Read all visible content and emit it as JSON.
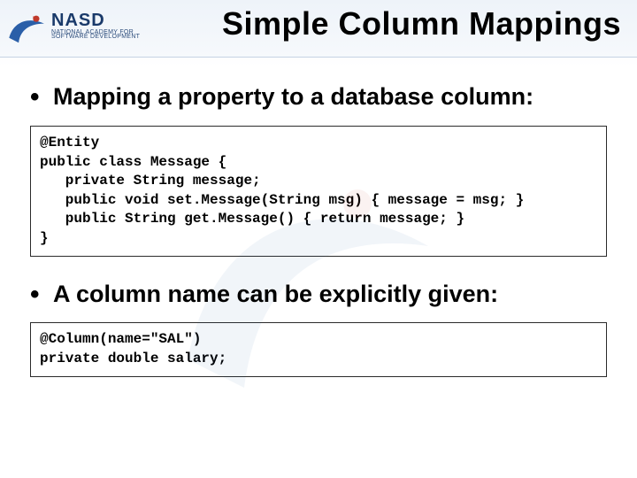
{
  "logo": {
    "name": "NASD",
    "sub1": "NATIONAL ACADEMY FOR",
    "sub2": "SOFTWARE DEVELOPMENT"
  },
  "title": "Simple Column Mappings",
  "bullets": [
    "Mapping a property to a database column:",
    "A column name can be explicitly given:"
  ],
  "code": {
    "block1": "@Entity\npublic class Message {\n   private String message;\n   public void set.Message(String msg) { message = msg; }\n   public String get.Message() { return message; }\n}",
    "block2": "@Column(name=\"SAL\")\nprivate double salary;"
  }
}
